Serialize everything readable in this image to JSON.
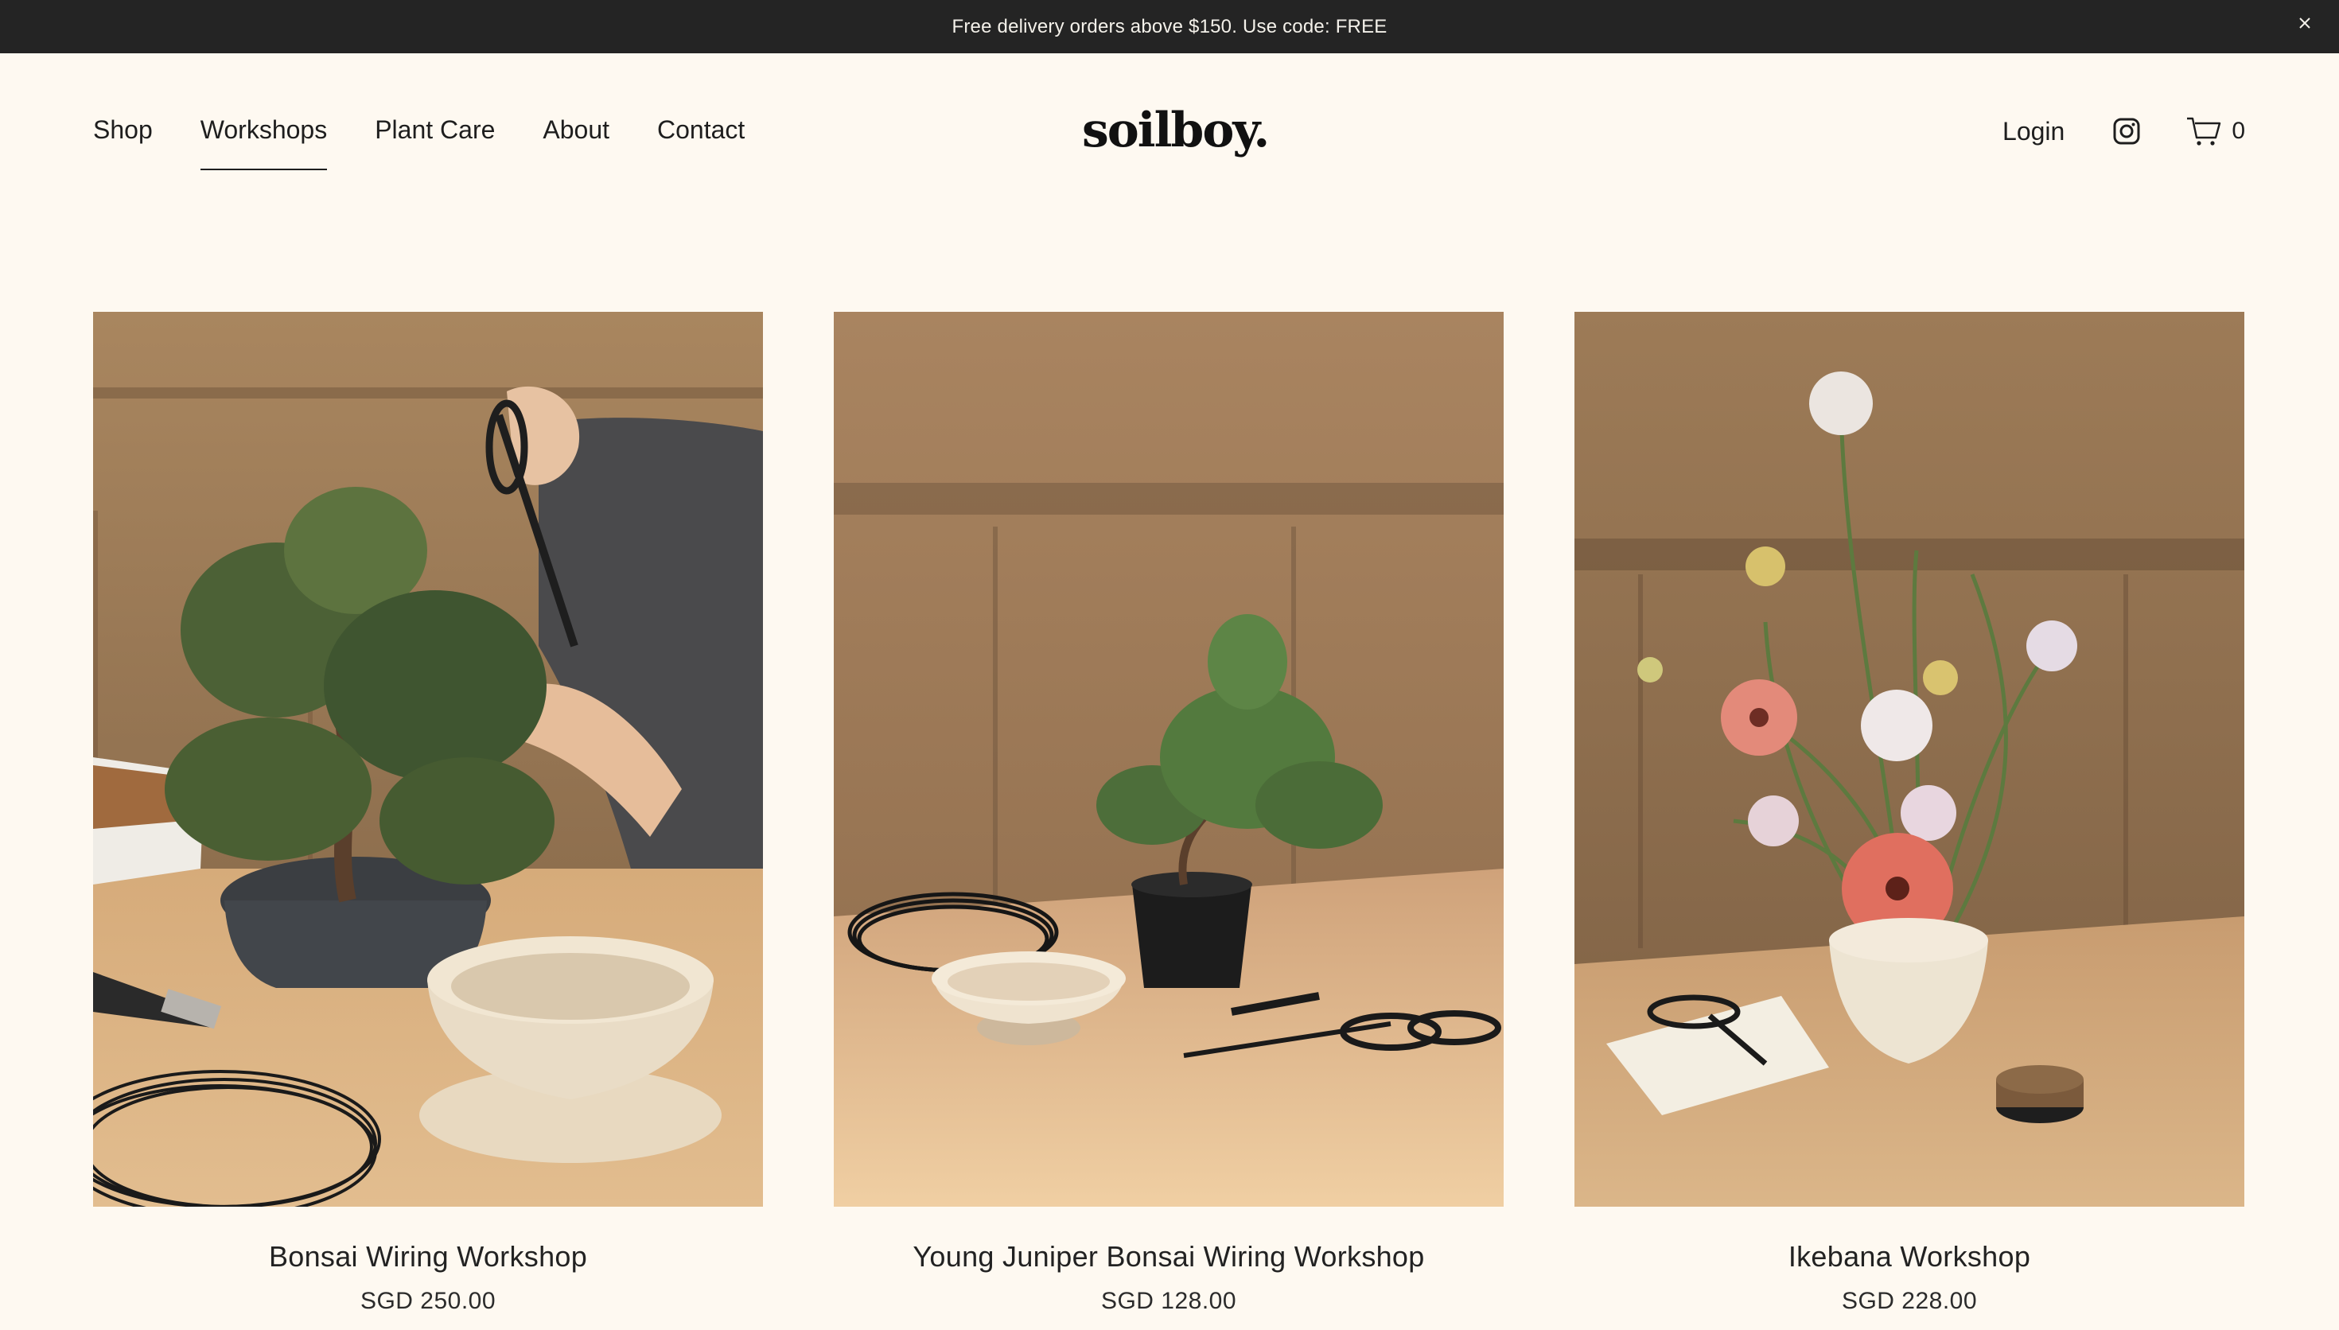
{
  "announcement": {
    "text": "Free delivery orders above $150. Use code: FREE"
  },
  "nav": {
    "items": [
      {
        "label": "Shop"
      },
      {
        "label": "Workshops"
      },
      {
        "label": "Plant Care"
      },
      {
        "label": "About"
      },
      {
        "label": "Contact"
      }
    ],
    "active": "Workshops"
  },
  "brand": {
    "logo": "soilboy."
  },
  "tools": {
    "login": "Login",
    "cart_count": "0"
  },
  "icons": [
    "close-icon",
    "instagram-icon",
    "cart-icon"
  ],
  "products": [
    {
      "title": "Bonsai Wiring Workshop",
      "price": "SGD 250.00"
    },
    {
      "title": "Young Juniper Bonsai Wiring Workshop",
      "price": "SGD 128.00"
    },
    {
      "title": "Ikebana Workshop",
      "price": "SGD 228.00"
    }
  ],
  "colors": {
    "background": "#fef9f1",
    "announcement_bar": "#242424",
    "text": "#1e1e1e"
  }
}
